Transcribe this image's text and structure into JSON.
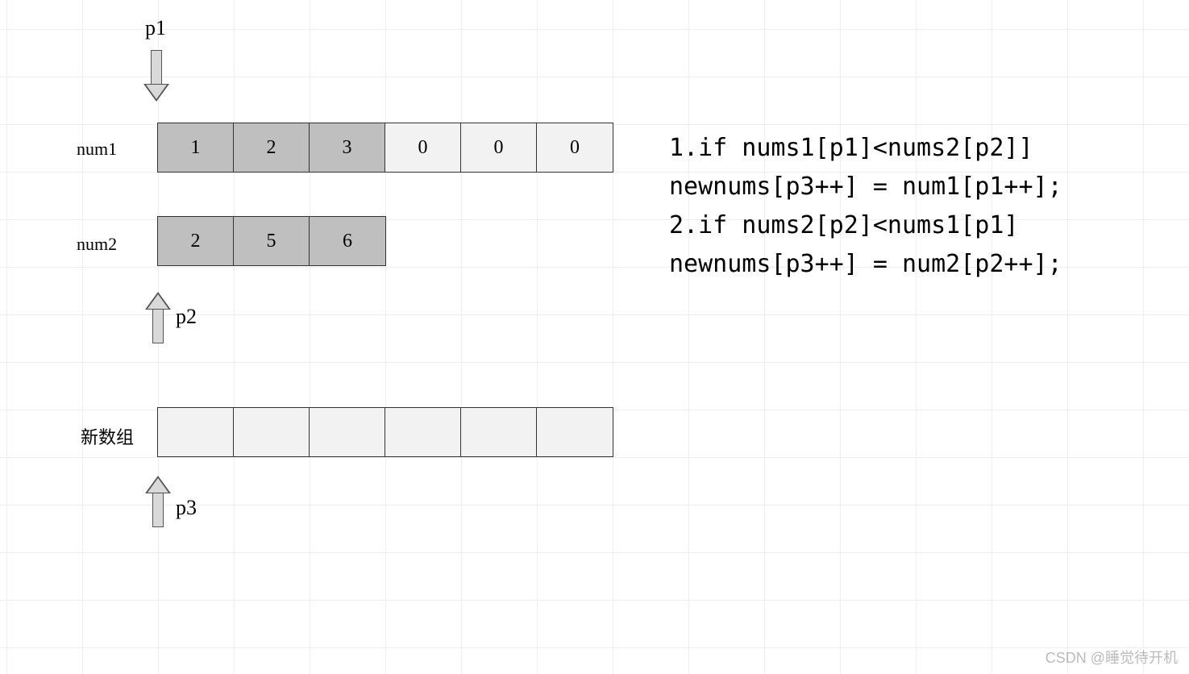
{
  "pointers": {
    "p1_label": "p1",
    "p2_label": "p2",
    "p3_label": "p3"
  },
  "arrays": {
    "num1_label": "num1",
    "num2_label": "num2",
    "newarray_label": "新数组",
    "num1": [
      "1",
      "2",
      "3",
      "0",
      "0",
      "0"
    ],
    "num2": [
      "2",
      "5",
      "6"
    ],
    "newarray": [
      "",
      "",
      "",
      "",
      "",
      ""
    ]
  },
  "code": {
    "line1": "1.if nums1[p1]<nums2[p2]]",
    "line2": "newnums[p3++] = num1[p1++];",
    "line3": "2.if nums2[p2]<nums1[p1]",
    "line4": "newnums[p3++] = num2[p2++];"
  },
  "watermark": "CSDN @睡觉待开机"
}
